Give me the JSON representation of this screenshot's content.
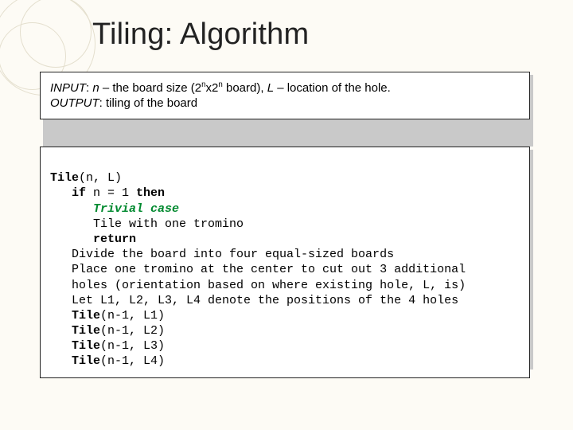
{
  "title": "Tiling: Algorithm",
  "spec": {
    "input_label": "INPUT",
    "input_var": "n",
    "input_dash": "  – the board size (2",
    "input_sup1": "n",
    "input_x": "x2",
    "input_sup2": "n",
    "input_board": " board), ",
    "input_L": "L",
    "input_rest": " – location of the hole.",
    "output_label": "OUTPUT",
    "output_rest": ": tiling of the board"
  },
  "code": {
    "l1a": "Tile",
    "l1b": "(n, L)",
    "l2a": "if",
    "l2b": " n = 1 ",
    "l2c": "then",
    "l3": "Trivial case",
    "l4": "Tile with one tromino",
    "l5": "return",
    "l6": "Divide the board into four equal-sized boards",
    "l7": "Place one tromino at the center to cut out 3 additional",
    "l8": "holes (orientation based on where existing hole, L, is)",
    "l9": "Let L1, L2, L3, L4 denote the positions of the 4 holes",
    "l10a": "Tile",
    "l10b": "(n-1, L1)",
    "l11a": "Tile",
    "l11b": "(n-1, L2)",
    "l12a": "Tile",
    "l12b": "(n-1, L3)",
    "l13a": "Tile",
    "l13b": "(n-1, L4)"
  }
}
